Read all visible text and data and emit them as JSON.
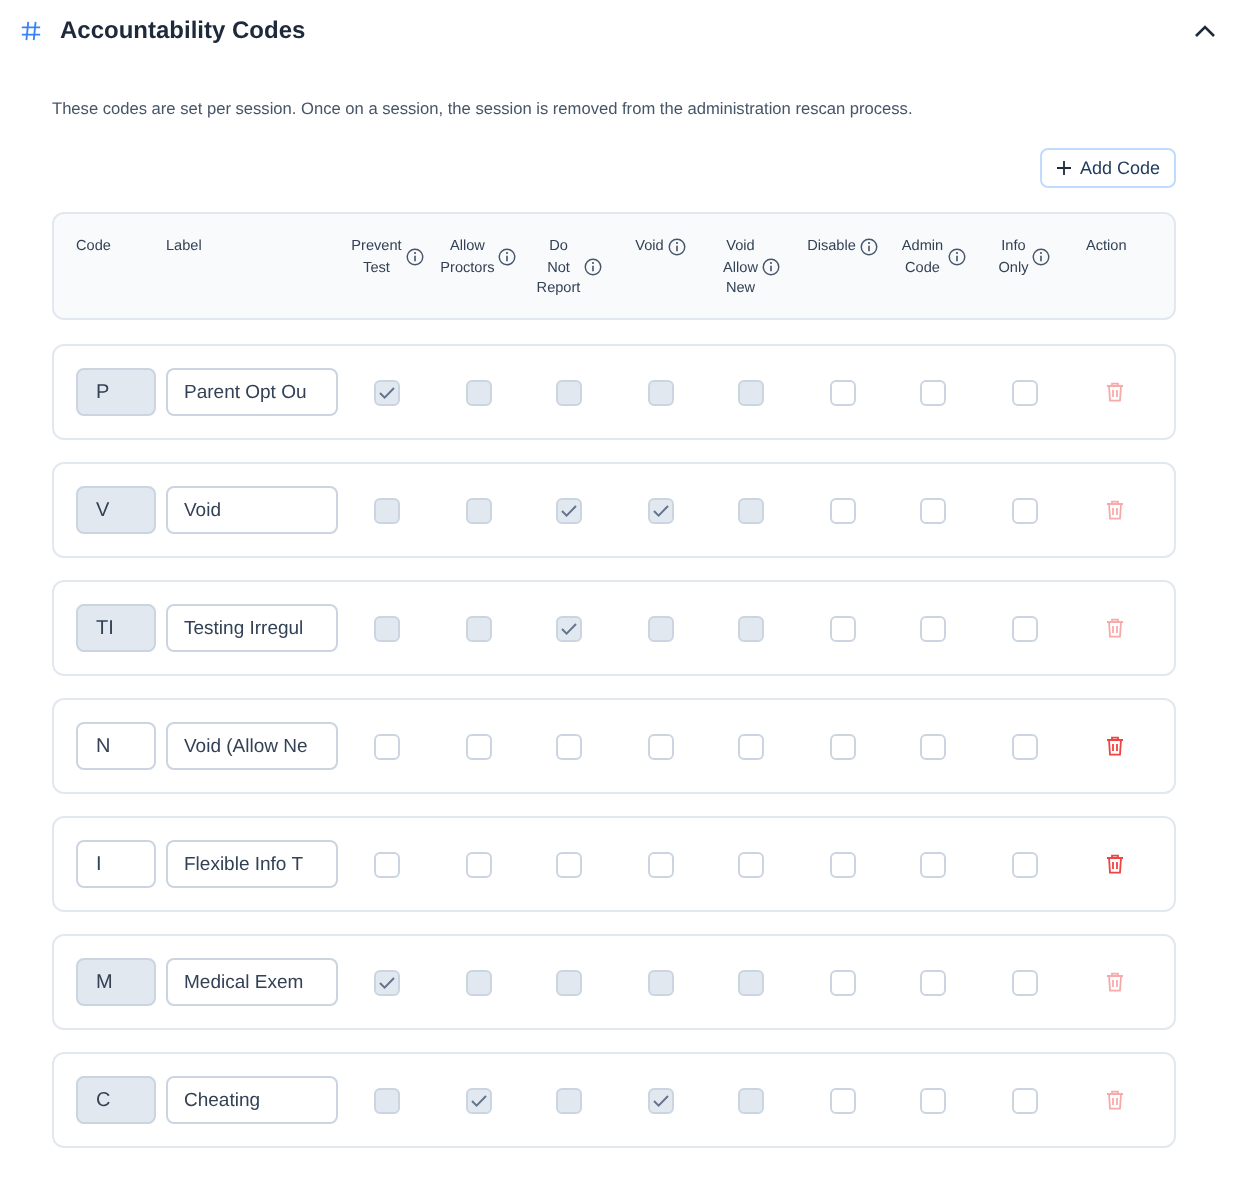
{
  "section": {
    "title": "Accountability Codes",
    "expanded": true
  },
  "description": "These codes are set per session. Once on a session, the session is removed from the administration rescan process.",
  "add_button": "Add Code",
  "columns": [
    {
      "label": "Code",
      "info": false
    },
    {
      "label": "Label",
      "info": false
    },
    {
      "label": "Prevent Test",
      "info": true
    },
    {
      "label": "Allow Proctors",
      "info": true
    },
    {
      "label": "Do Not Report",
      "info": true
    },
    {
      "label": "Void",
      "info": true
    },
    {
      "label": "Void Allow New",
      "info": true
    },
    {
      "label": "Disable",
      "info": true
    },
    {
      "label": "Admin Code",
      "info": true
    },
    {
      "label": "Info Only",
      "info": true
    },
    {
      "label": "Action",
      "info": false
    }
  ],
  "rows": [
    {
      "code": "P",
      "code_disabled": true,
      "label": "Parent Opt Ou",
      "delete_disabled": true,
      "flags": [
        {
          "checked": true,
          "disabled": true
        },
        {
          "checked": false,
          "disabled": true
        },
        {
          "checked": false,
          "disabled": true
        },
        {
          "checked": false,
          "disabled": true
        },
        {
          "checked": false,
          "disabled": true
        },
        {
          "checked": false,
          "disabled": false
        },
        {
          "checked": false,
          "disabled": false
        },
        {
          "checked": false,
          "disabled": false
        }
      ]
    },
    {
      "code": "V",
      "code_disabled": true,
      "label": "Void",
      "delete_disabled": true,
      "flags": [
        {
          "checked": false,
          "disabled": true
        },
        {
          "checked": false,
          "disabled": true
        },
        {
          "checked": true,
          "disabled": true
        },
        {
          "checked": true,
          "disabled": true
        },
        {
          "checked": false,
          "disabled": true
        },
        {
          "checked": false,
          "disabled": false
        },
        {
          "checked": false,
          "disabled": false
        },
        {
          "checked": false,
          "disabled": false
        }
      ]
    },
    {
      "code": "TI",
      "code_disabled": true,
      "label": "Testing Irregul",
      "delete_disabled": true,
      "flags": [
        {
          "checked": false,
          "disabled": true
        },
        {
          "checked": false,
          "disabled": true
        },
        {
          "checked": true,
          "disabled": true
        },
        {
          "checked": false,
          "disabled": true
        },
        {
          "checked": false,
          "disabled": true
        },
        {
          "checked": false,
          "disabled": false
        },
        {
          "checked": false,
          "disabled": false
        },
        {
          "checked": false,
          "disabled": false
        }
      ]
    },
    {
      "code": "N",
      "code_disabled": false,
      "label": "Void (Allow Ne",
      "delete_disabled": false,
      "flags": [
        {
          "checked": false,
          "disabled": false
        },
        {
          "checked": false,
          "disabled": false
        },
        {
          "checked": false,
          "disabled": false
        },
        {
          "checked": false,
          "disabled": false
        },
        {
          "checked": false,
          "disabled": false
        },
        {
          "checked": false,
          "disabled": false
        },
        {
          "checked": false,
          "disabled": false
        },
        {
          "checked": false,
          "disabled": false
        }
      ]
    },
    {
      "code": "I",
      "code_disabled": false,
      "label": "Flexible Info T",
      "delete_disabled": false,
      "flags": [
        {
          "checked": false,
          "disabled": false
        },
        {
          "checked": false,
          "disabled": false
        },
        {
          "checked": false,
          "disabled": false
        },
        {
          "checked": false,
          "disabled": false
        },
        {
          "checked": false,
          "disabled": false
        },
        {
          "checked": false,
          "disabled": false
        },
        {
          "checked": false,
          "disabled": false
        },
        {
          "checked": false,
          "disabled": false
        }
      ]
    },
    {
      "code": "M",
      "code_disabled": true,
      "label": "Medical Exem",
      "delete_disabled": true,
      "flags": [
        {
          "checked": true,
          "disabled": true
        },
        {
          "checked": false,
          "disabled": true
        },
        {
          "checked": false,
          "disabled": true
        },
        {
          "checked": false,
          "disabled": true
        },
        {
          "checked": false,
          "disabled": true
        },
        {
          "checked": false,
          "disabled": false
        },
        {
          "checked": false,
          "disabled": false
        },
        {
          "checked": false,
          "disabled": false
        }
      ]
    },
    {
      "code": "C",
      "code_disabled": true,
      "label": "Cheating",
      "delete_disabled": true,
      "flags": [
        {
          "checked": false,
          "disabled": true
        },
        {
          "checked": true,
          "disabled": true
        },
        {
          "checked": false,
          "disabled": true
        },
        {
          "checked": true,
          "disabled": true
        },
        {
          "checked": false,
          "disabled": true
        },
        {
          "checked": false,
          "disabled": false
        },
        {
          "checked": false,
          "disabled": false
        },
        {
          "checked": false,
          "disabled": false
        }
      ]
    }
  ]
}
